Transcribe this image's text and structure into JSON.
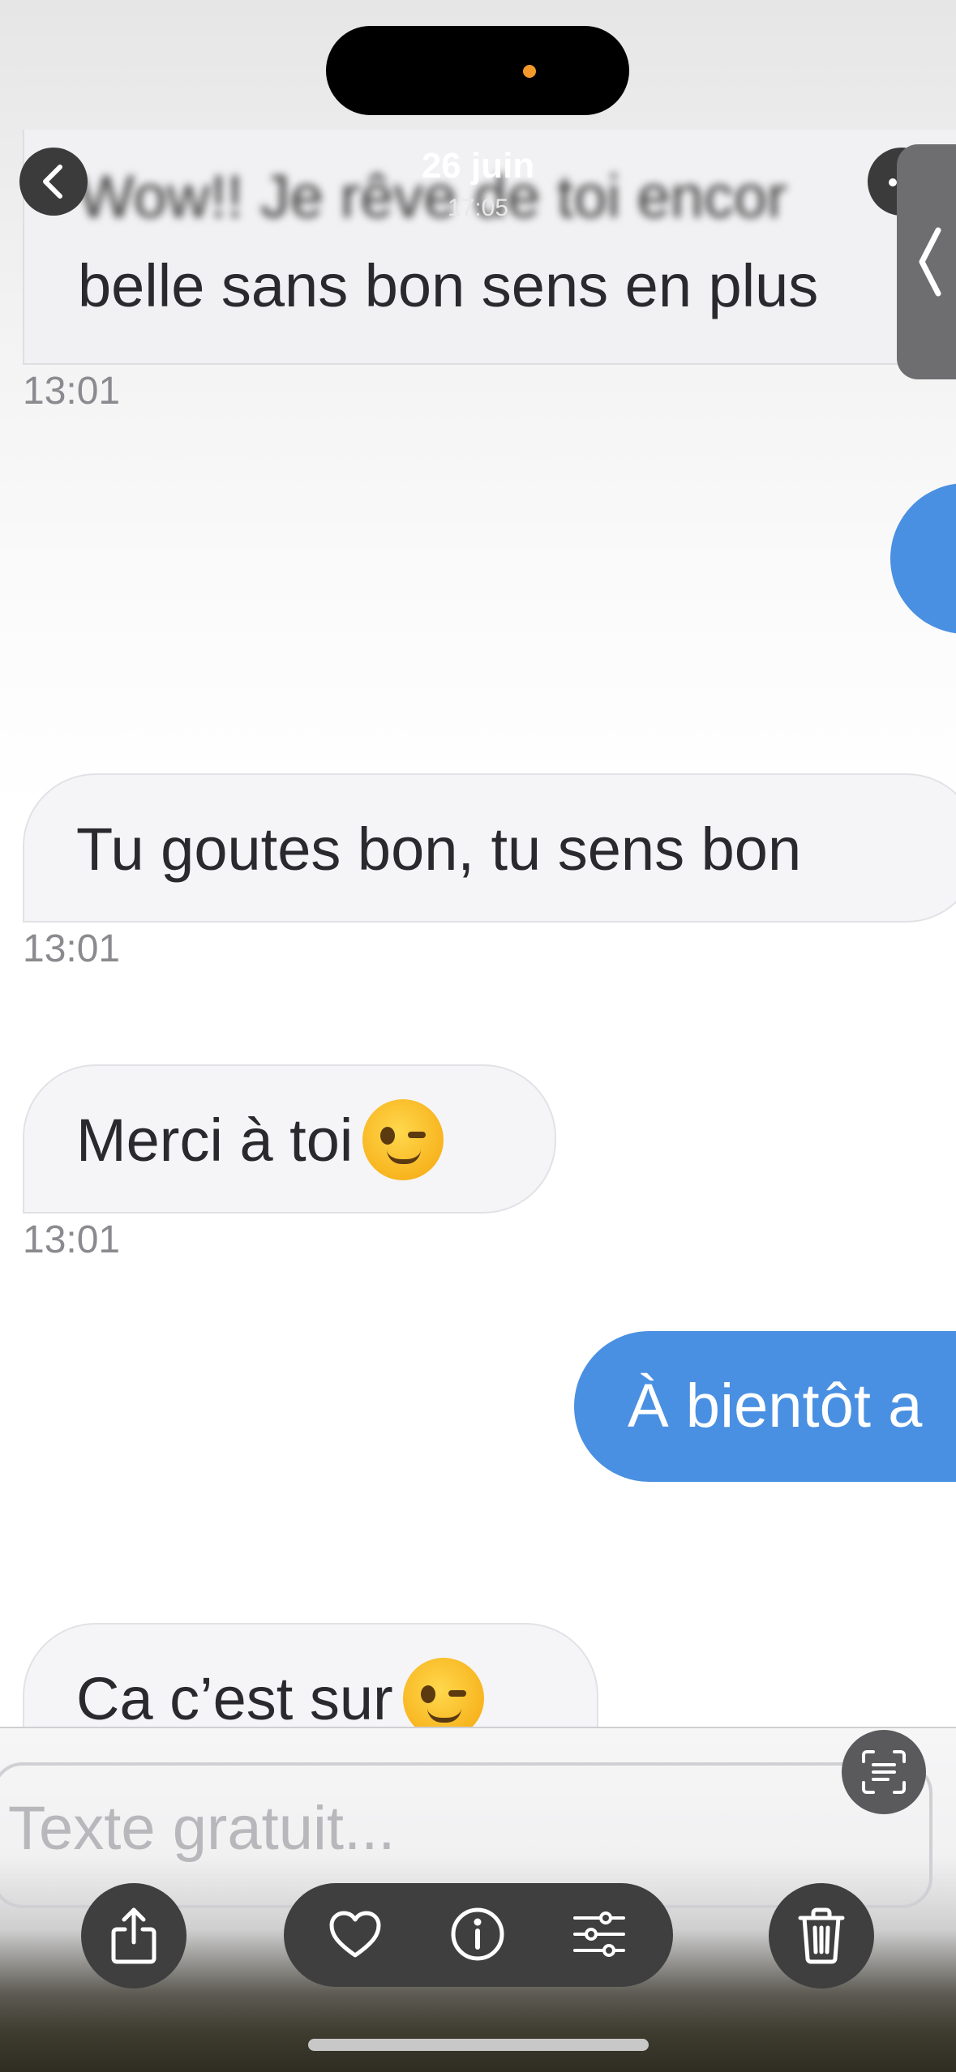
{
  "header": {
    "date": "26 juin",
    "time": "17:05"
  },
  "messages": {
    "top_partial": {
      "line1": "Wow!! Je rêve de toi encor",
      "line2": "belle sans bon sens en plus",
      "time": "13:01"
    },
    "m1": {
      "text": "Tu goutes bon, tu sens bon",
      "time": "13:01"
    },
    "m2": {
      "text": "Merci à toi",
      "time": "13:01"
    },
    "out2": {
      "text": "À bientôt a"
    },
    "m3": {
      "text": "Ca c’est sur"
    }
  },
  "input": {
    "placeholder": "Texte gratuit..."
  },
  "toolbar": {
    "icons": [
      "share-icon",
      "heart-icon",
      "info-icon",
      "sliders-icon",
      "trash-icon",
      "scan-text-icon"
    ]
  },
  "colors": {
    "outgoing_bubble": "#4a90e2",
    "incoming_bubble": "#f5f5f7",
    "status_dot": "#f39a2b"
  }
}
